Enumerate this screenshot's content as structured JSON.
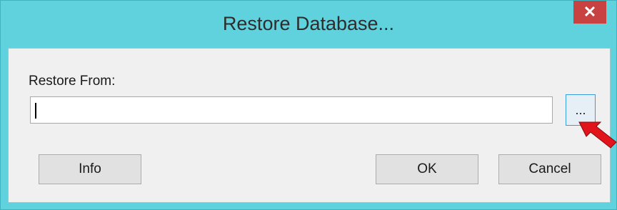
{
  "window": {
    "title": "Restore Database...",
    "close_label": "✕"
  },
  "form": {
    "restore_from_label": "Restore From:",
    "path_value": "",
    "browse_label": "..."
  },
  "buttons": {
    "info": "Info",
    "ok": "OK",
    "cancel": "Cancel"
  },
  "colors": {
    "title_bar": "#5fd2de",
    "close_button": "#c84242",
    "annotation_arrow": "#e0141a"
  },
  "icons": {
    "close": "close-icon",
    "annotation": "red-arrow-icon"
  }
}
